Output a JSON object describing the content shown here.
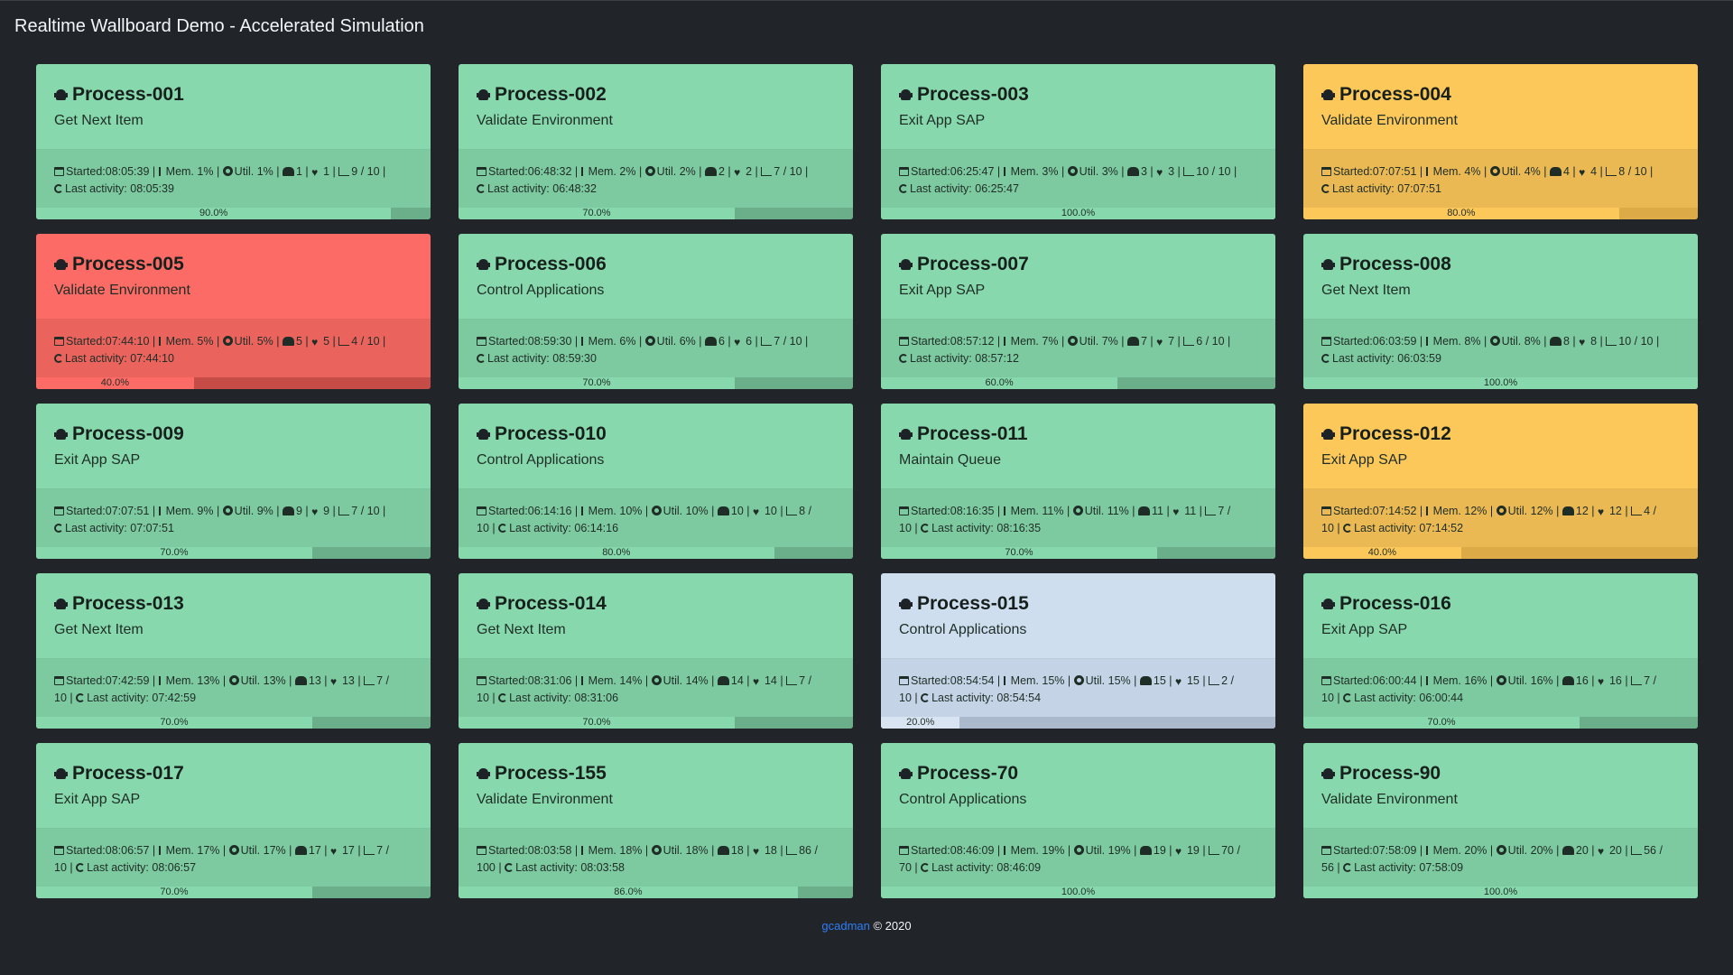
{
  "header": {
    "title": "Realtime Wallboard Demo - Accelerated Simulation"
  },
  "colors": {
    "green": "#87d9ad",
    "orange": "#fcc85a",
    "red": "#fc6b65",
    "blue": "#cfdeef",
    "background": "#212529",
    "link": "#2f7cf6"
  },
  "labels": {
    "started": "Started:",
    "mem": "Mem.",
    "util": "Util.",
    "last_activity": "Last activity:"
  },
  "processes": [
    {
      "name": "Process-001",
      "task": "Get Next Item",
      "status": "green",
      "started": "08:05:39",
      "mem": "1%",
      "util": "1%",
      "users": "1",
      "health": "1",
      "items": "9 / 10",
      "last": "08:05:39",
      "progress": 90,
      "progress_label": "90.0%"
    },
    {
      "name": "Process-002",
      "task": "Validate Environment",
      "status": "green",
      "started": "06:48:32",
      "mem": "2%",
      "util": "2%",
      "users": "2",
      "health": "2",
      "items": "7 / 10",
      "last": "06:48:32",
      "progress": 70,
      "progress_label": "70.0%"
    },
    {
      "name": "Process-003",
      "task": "Exit App SAP",
      "status": "green",
      "started": "06:25:47",
      "mem": "3%",
      "util": "3%",
      "users": "3",
      "health": "3",
      "items": "10 / 10",
      "last": "06:25:47",
      "progress": 100,
      "progress_label": "100.0%"
    },
    {
      "name": "Process-004",
      "task": "Validate Environment",
      "status": "orange",
      "started": "07:07:51",
      "mem": "4%",
      "util": "4%",
      "users": "4",
      "health": "4",
      "items": "8 / 10",
      "last": "07:07:51",
      "progress": 80,
      "progress_label": "80.0%"
    },
    {
      "name": "Process-005",
      "task": "Validate Environment",
      "status": "red",
      "started": "07:44:10",
      "mem": "5%",
      "util": "5%",
      "users": "5",
      "health": "5",
      "items": "4 / 10",
      "last": "07:44:10",
      "progress": 40,
      "progress_label": "40.0%"
    },
    {
      "name": "Process-006",
      "task": "Control Applications",
      "status": "green",
      "started": "08:59:30",
      "mem": "6%",
      "util": "6%",
      "users": "6",
      "health": "6",
      "items": "7 / 10",
      "last": "08:59:30",
      "progress": 70,
      "progress_label": "70.0%"
    },
    {
      "name": "Process-007",
      "task": "Exit App SAP",
      "status": "green",
      "started": "08:57:12",
      "mem": "7%",
      "util": "7%",
      "users": "7",
      "health": "7",
      "items": "6 / 10",
      "last": "08:57:12",
      "progress": 60,
      "progress_label": "60.0%"
    },
    {
      "name": "Process-008",
      "task": "Get Next Item",
      "status": "green",
      "started": "06:03:59",
      "mem": "8%",
      "util": "8%",
      "users": "8",
      "health": "8",
      "items": "10 / 10",
      "last": "06:03:59",
      "progress": 100,
      "progress_label": "100.0%"
    },
    {
      "name": "Process-009",
      "task": "Exit App SAP",
      "status": "green",
      "started": "07:07:51",
      "mem": "9%",
      "util": "9%",
      "users": "9",
      "health": "9",
      "items": "7 / 10",
      "last": "07:07:51",
      "progress": 70,
      "progress_label": "70.0%"
    },
    {
      "name": "Process-010",
      "task": "Control Applications",
      "status": "green",
      "started": "06:14:16",
      "mem": "10%",
      "util": "10%",
      "users": "10",
      "health": "10",
      "items": "8 / 10",
      "last": "06:14:16",
      "progress": 80,
      "progress_label": "80.0%"
    },
    {
      "name": "Process-011",
      "task": "Maintain Queue",
      "status": "green",
      "started": "08:16:35",
      "mem": "11%",
      "util": "11%",
      "users": "11",
      "health": "11",
      "items": "7 / 10",
      "last": "08:16:35",
      "progress": 70,
      "progress_label": "70.0%"
    },
    {
      "name": "Process-012",
      "task": "Exit App SAP",
      "status": "orange",
      "started": "07:14:52",
      "mem": "12%",
      "util": "12%",
      "users": "12",
      "health": "12",
      "items": "4 / 10",
      "last": "07:14:52",
      "progress": 40,
      "progress_label": "40.0%"
    },
    {
      "name": "Process-013",
      "task": "Get Next Item",
      "status": "green",
      "started": "07:42:59",
      "mem": "13%",
      "util": "13%",
      "users": "13",
      "health": "13",
      "items": "7 / 10",
      "last": "07:42:59",
      "progress": 70,
      "progress_label": "70.0%"
    },
    {
      "name": "Process-014",
      "task": "Get Next Item",
      "status": "green",
      "started": "08:31:06",
      "mem": "14%",
      "util": "14%",
      "users": "14",
      "health": "14",
      "items": "7 / 10",
      "last": "08:31:06",
      "progress": 70,
      "progress_label": "70.0%"
    },
    {
      "name": "Process-015",
      "task": "Control Applications",
      "status": "blue",
      "started": "08:54:54",
      "mem": "15%",
      "util": "15%",
      "users": "15",
      "health": "15",
      "items": "2 / 10",
      "last": "08:54:54",
      "progress": 20,
      "progress_label": "20.0%"
    },
    {
      "name": "Process-016",
      "task": "Exit App SAP",
      "status": "green",
      "started": "06:00:44",
      "mem": "16%",
      "util": "16%",
      "users": "16",
      "health": "16",
      "items": "7 / 10",
      "last": "06:00:44",
      "progress": 70,
      "progress_label": "70.0%"
    },
    {
      "name": "Process-017",
      "task": "Exit App SAP",
      "status": "green",
      "started": "08:06:57",
      "mem": "17%",
      "util": "17%",
      "users": "17",
      "health": "17",
      "items": "7 / 10",
      "last": "08:06:57",
      "progress": 70,
      "progress_label": "70.0%"
    },
    {
      "name": "Process-155",
      "task": "Validate Environment",
      "status": "green",
      "started": "08:03:58",
      "mem": "18%",
      "util": "18%",
      "users": "18",
      "health": "18",
      "items": "86 / 100",
      "last": "08:03:58",
      "progress": 86,
      "progress_label": "86.0%"
    },
    {
      "name": "Process-70",
      "task": "Control Applications",
      "status": "green",
      "started": "08:46:09",
      "mem": "19%",
      "util": "19%",
      "users": "19",
      "health": "19",
      "items": "70 / 70",
      "last": "08:46:09",
      "progress": 100,
      "progress_label": "100.0%"
    },
    {
      "name": "Process-90",
      "task": "Validate Environment",
      "status": "green",
      "started": "07:58:09",
      "mem": "20%",
      "util": "20%",
      "users": "20",
      "health": "20",
      "items": "56 / 56",
      "last": "07:58:09",
      "progress": 100,
      "progress_label": "100.0%"
    }
  ],
  "footer": {
    "link_text": "gcadman",
    "copyright": "© 2020"
  }
}
